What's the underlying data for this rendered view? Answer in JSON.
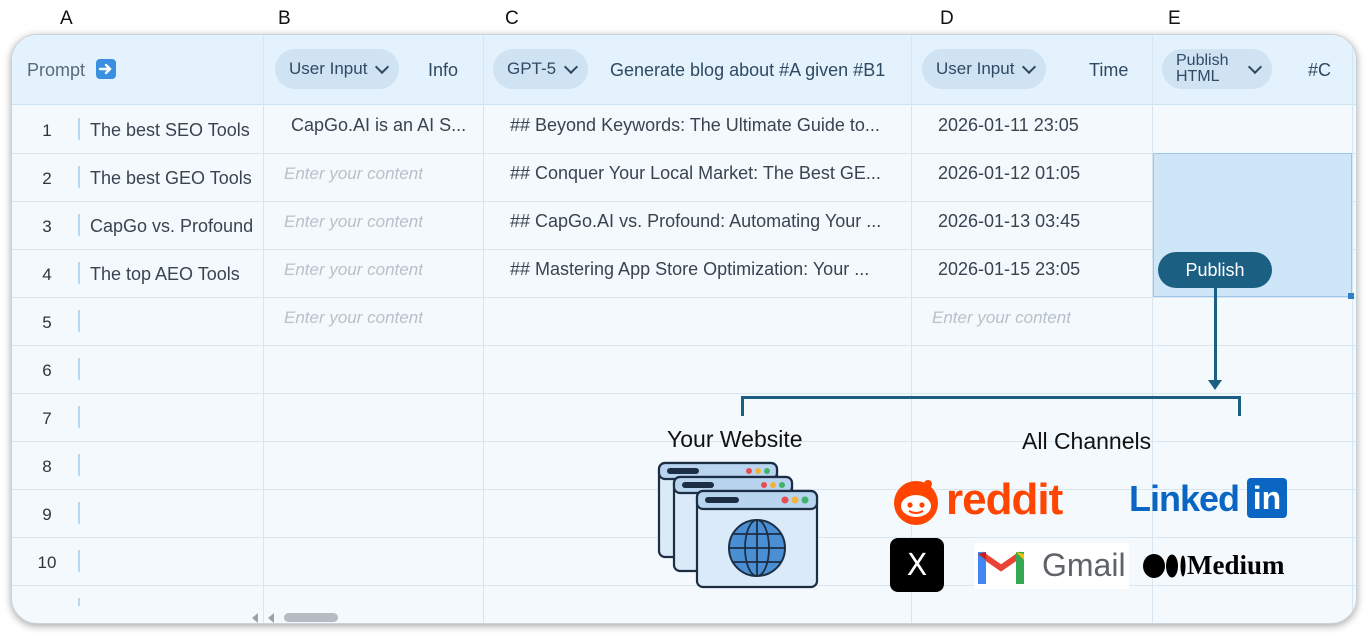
{
  "columns": {
    "letters": [
      "A",
      "B",
      "C",
      "D",
      "E"
    ],
    "a": {
      "title": "Prompt",
      "icon": "right-arrow-emoji-icon"
    },
    "b": {
      "type": "User Input",
      "label": "Info"
    },
    "c": {
      "type": "GPT-5",
      "label": "Generate blog about #A given #B1"
    },
    "d": {
      "type": "User Input",
      "label": "Time"
    },
    "e": {
      "type_line1": "Publish",
      "type_line2": "HTML",
      "label": "#C"
    }
  },
  "rows": [
    {
      "num": "1",
      "a": "The best SEO Tools",
      "b": "CapGo.AI is an AI S...",
      "c": "## Beyond Keywords: The Ultimate Guide to...",
      "d": "2026-01-11 23:05"
    },
    {
      "num": "2",
      "a": "The best GEO Tools",
      "b": "",
      "c": "## Conquer Your Local Market: The Best GE...",
      "d": "2026-01-12 01:05"
    },
    {
      "num": "3",
      "a": "CapGo vs. Profound",
      "b": "",
      "c": "## CapGo.AI vs. Profound: Automating Your ...",
      "d": "2026-01-13 03:45"
    },
    {
      "num": "4",
      "a": "The top AEO Tools",
      "b": "",
      "c": "## Mastering App Store Optimization: Your ...",
      "d": "2026-01-15 23:05"
    },
    {
      "num": "5",
      "a": "",
      "b": "",
      "c": "",
      "d": ""
    },
    {
      "num": "6"
    },
    {
      "num": "7"
    },
    {
      "num": "8"
    },
    {
      "num": "9"
    },
    {
      "num": "10"
    }
  ],
  "placeholder": "Enter your content",
  "publish_button": "Publish",
  "illustration": {
    "website_label": "Your Website",
    "channels_label": "All Channels",
    "channels": [
      "reddit",
      "Linked",
      "in",
      "X",
      "Gmail",
      "Medium"
    ]
  },
  "colors": {
    "accent": "#1b5f82",
    "header_bg": "#e3f2fc",
    "pill_bg": "#cfe3f3",
    "selection": "#cfe5f8",
    "reddit": "#ff4500",
    "linkedin": "#0a66c2"
  }
}
